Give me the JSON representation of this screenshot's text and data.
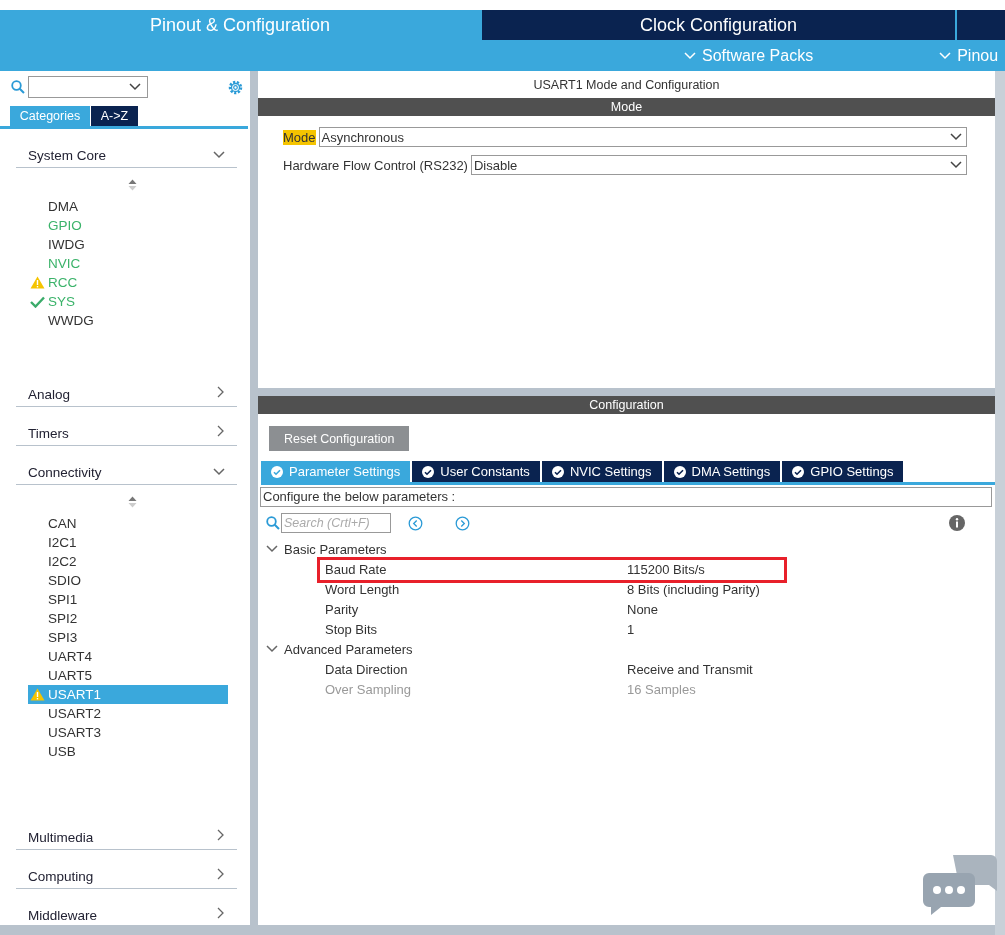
{
  "top_tabs": [
    {
      "label": "Pinout & Configuration",
      "selected": true
    },
    {
      "label": "Clock Configuration",
      "selected": false
    }
  ],
  "sub_menus": [
    {
      "label": "Software Packs"
    },
    {
      "label": "Pinou"
    }
  ],
  "sidebar": {
    "view_tabs": [
      {
        "label": "Categories",
        "selected": true
      },
      {
        "label": "A->Z",
        "selected": false
      }
    ],
    "categories": [
      {
        "label": "System Core",
        "expanded": true,
        "items": [
          {
            "label": "DMA",
            "kind": "plain",
            "configured": false,
            "selected": false
          },
          {
            "label": "GPIO",
            "kind": "plain",
            "configured": true,
            "selected": false
          },
          {
            "label": "IWDG",
            "kind": "plain",
            "configured": false,
            "selected": false
          },
          {
            "label": "NVIC",
            "kind": "plain",
            "configured": true,
            "selected": false
          },
          {
            "label": "RCC",
            "kind": "warning",
            "configured": true,
            "selected": false
          },
          {
            "label": "SYS",
            "kind": "ok",
            "configured": true,
            "selected": false
          },
          {
            "label": "WWDG",
            "kind": "plain",
            "configured": false,
            "selected": false
          }
        ]
      },
      {
        "label": "Analog",
        "expanded": false
      },
      {
        "label": "Timers",
        "expanded": false
      },
      {
        "label": "Connectivity",
        "expanded": true,
        "items": [
          {
            "label": "CAN",
            "kind": "plain",
            "configured": false,
            "selected": false
          },
          {
            "label": "I2C1",
            "kind": "plain",
            "configured": false,
            "selected": false
          },
          {
            "label": "I2C2",
            "kind": "plain",
            "configured": false,
            "selected": false
          },
          {
            "label": "SDIO",
            "kind": "plain",
            "configured": false,
            "selected": false
          },
          {
            "label": "SPI1",
            "kind": "plain",
            "configured": false,
            "selected": false
          },
          {
            "label": "SPI2",
            "kind": "plain",
            "configured": false,
            "selected": false
          },
          {
            "label": "SPI3",
            "kind": "plain",
            "configured": false,
            "selected": false
          },
          {
            "label": "UART4",
            "kind": "plain",
            "configured": false,
            "selected": false
          },
          {
            "label": "UART5",
            "kind": "plain",
            "configured": false,
            "selected": false
          },
          {
            "label": "USART1",
            "kind": "warning",
            "configured": false,
            "selected": true
          },
          {
            "label": "USART2",
            "kind": "plain",
            "configured": false,
            "selected": false
          },
          {
            "label": "USART3",
            "kind": "plain",
            "configured": false,
            "selected": false
          },
          {
            "label": "USB",
            "kind": "plain",
            "configured": false,
            "selected": false
          }
        ]
      },
      {
        "label": "Multimedia",
        "expanded": false
      },
      {
        "label": "Computing",
        "expanded": false
      },
      {
        "label": "Middleware",
        "expanded": false
      }
    ]
  },
  "panel_title": "USART1 Mode and Configuration",
  "mode": {
    "header": "Mode",
    "fields": [
      {
        "label": "Mode",
        "value": "Asynchronous",
        "highlighted": true
      },
      {
        "label": "Hardware Flow Control (RS232)",
        "value": "Disable",
        "highlighted": false
      }
    ]
  },
  "configuration": {
    "header": "Configuration",
    "reset_button": "Reset Configuration",
    "tabs": [
      {
        "label": "Parameter Settings",
        "selected": true
      },
      {
        "label": "User Constants",
        "selected": false
      },
      {
        "label": "NVIC Settings",
        "selected": false
      },
      {
        "label": "DMA Settings",
        "selected": false
      },
      {
        "label": "GPIO Settings",
        "selected": false
      }
    ],
    "hint": "Configure the below parameters :",
    "search": {
      "placeholder": "Search (Crtl+F)"
    },
    "groups": [
      {
        "label": "Basic Parameters",
        "expanded": true,
        "params": [
          {
            "name": "Baud Rate",
            "value": "115200 Bits/s",
            "disabled": false,
            "annotated": true
          },
          {
            "name": "Word Length",
            "value": "8 Bits (including Parity)",
            "disabled": false,
            "annotated": false
          },
          {
            "name": "Parity",
            "value": "None",
            "disabled": false,
            "annotated": false
          },
          {
            "name": "Stop Bits",
            "value": "1",
            "disabled": false,
            "annotated": false
          }
        ]
      },
      {
        "label": "Advanced Parameters",
        "expanded": true,
        "params": [
          {
            "name": "Data Direction",
            "value": "Receive and Transmit",
            "disabled": false,
            "annotated": false
          },
          {
            "name": "Over Sampling",
            "value": "16 Samples",
            "disabled": true,
            "annotated": false
          }
        ]
      }
    ]
  }
}
